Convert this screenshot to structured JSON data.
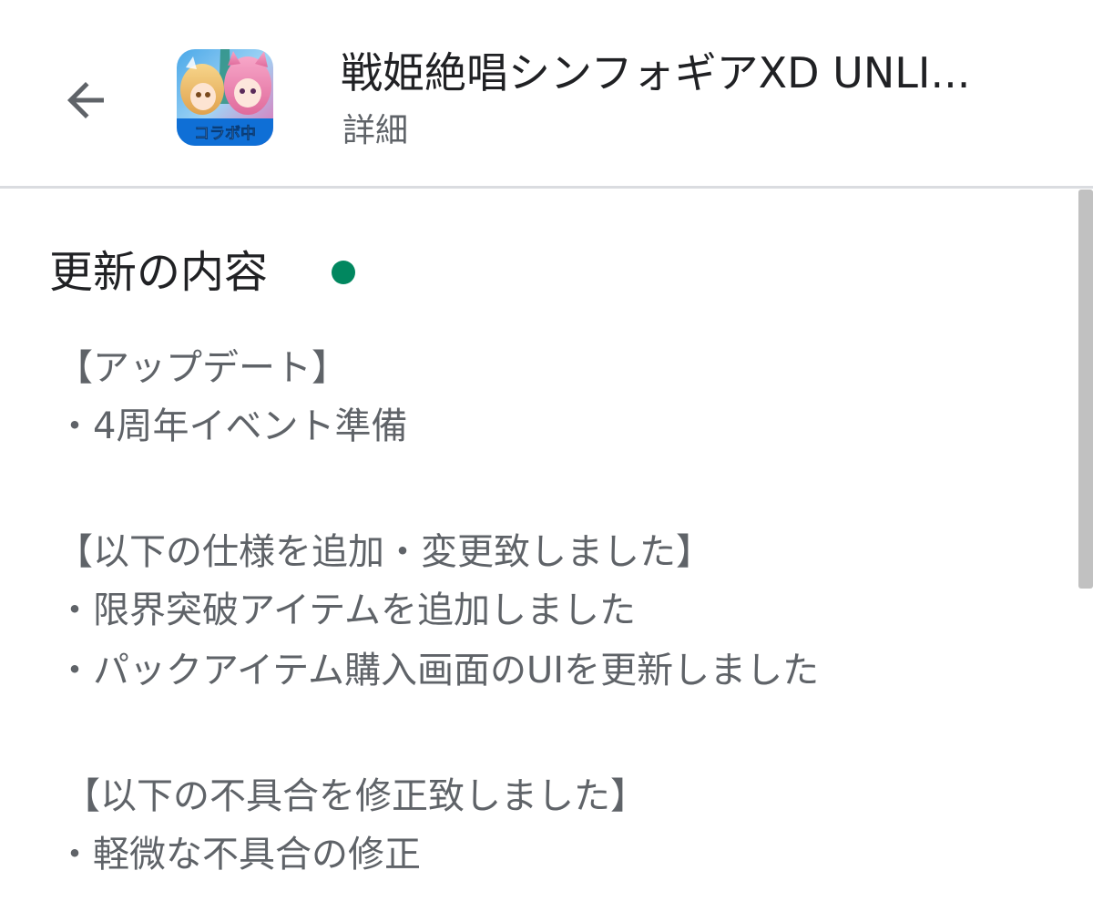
{
  "header": {
    "app_title": "戦姫絶唱シンフォギアXD UNLI...",
    "subtitle": "詳細",
    "app_icon_badge": "コラボ中",
    "back_icon": "arrow-back-icon"
  },
  "section": {
    "title": "更新の内容",
    "new_indicator_color": "#01875f"
  },
  "release_notes": [
    "【アップデート】",
    "・4周年イベント準備",
    "【以下の仕様を追加・変更致しました】",
    "・限界突破アイテムを追加しました",
    "・パックアイテム購入画面のUIを更新しました",
    "【以下の不具合を修正致しました】",
    "・軽微な不具合の修正"
  ]
}
